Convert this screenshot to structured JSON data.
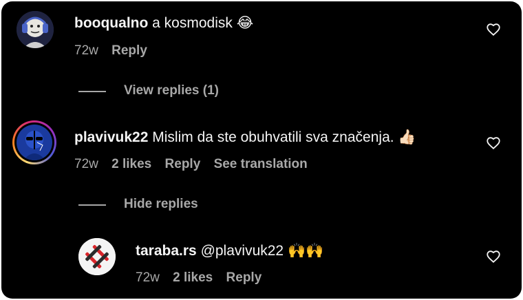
{
  "comments": [
    {
      "username": "booqualno",
      "text": "a kosmodisk 😂",
      "time": "72w",
      "reply_label": "Reply",
      "view_replies_label": "View replies (1)"
    },
    {
      "username": "plavivuk22",
      "text": "Mislim da ste obuhvatili sva značenja. 👍🏻",
      "time": "72w",
      "likes": "2 likes",
      "reply_label": "Reply",
      "translation_label": "See translation",
      "hide_replies_label": "Hide replies"
    },
    {
      "username": "taraba.rs",
      "text": "@plavivuk22 🙌🙌",
      "time": "72w",
      "likes": "2 likes",
      "reply_label": "Reply"
    }
  ],
  "icons": {
    "like": "heart-outline-icon"
  },
  "colors": {
    "background": "#000000",
    "primary_text": "#f5f5f5",
    "secondary_text": "#a8a8a8"
  }
}
